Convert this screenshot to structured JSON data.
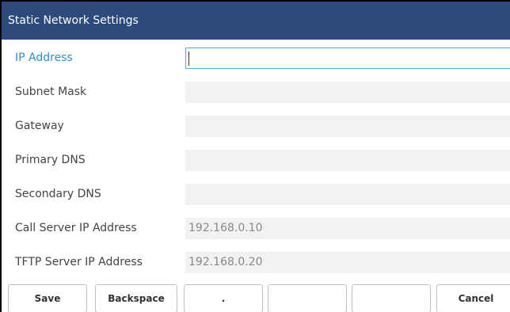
{
  "title": "Static Network Settings",
  "fields": [
    {
      "label": "IP Address",
      "value": "",
      "active": true
    },
    {
      "label": "Subnet Mask",
      "value": ""
    },
    {
      "label": "Gateway",
      "value": ""
    },
    {
      "label": "Primary DNS",
      "value": ""
    },
    {
      "label": "Secondary DNS",
      "value": ""
    },
    {
      "label": "Call Server IP Address",
      "value": "192.168.0.10"
    },
    {
      "label": "TFTP Server IP Address",
      "value": "192.168.0.20"
    }
  ],
  "softkeys": [
    "Save",
    "Backspace",
    ".",
    "",
    "",
    "Cancel"
  ],
  "colors": {
    "title_bar": "#2c4a7c",
    "active_label": "#2e8fce",
    "field_bg": "#f2f2f2",
    "active_border": "#5aaee0"
  }
}
